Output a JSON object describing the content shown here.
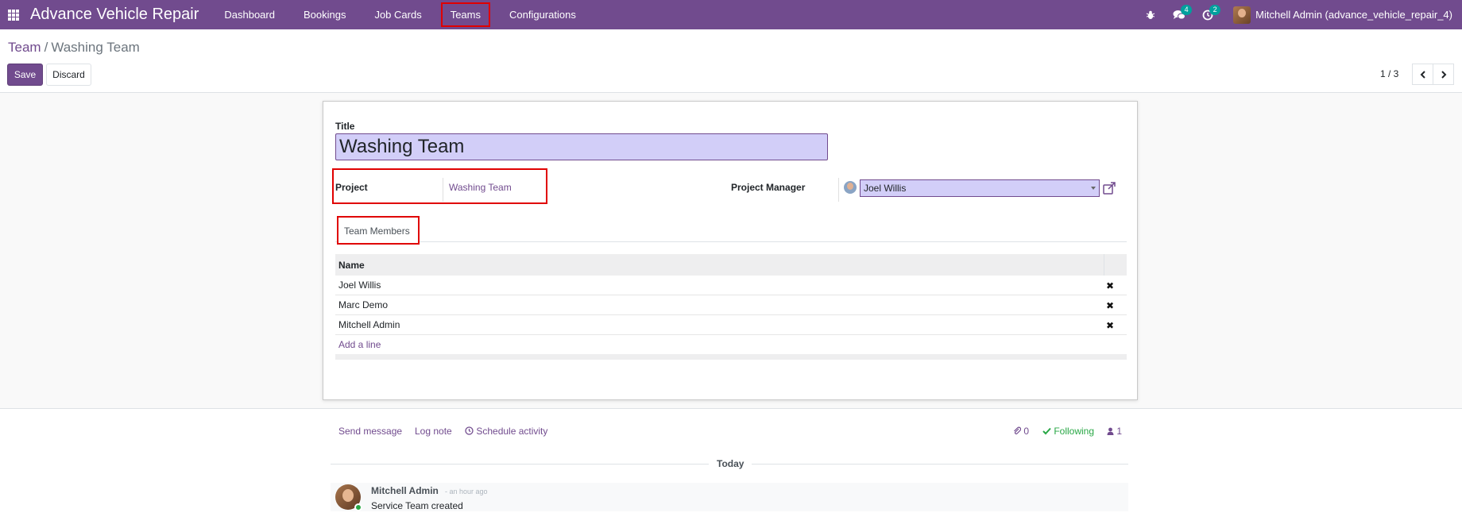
{
  "navbar": {
    "brand": "Advance Vehicle Repair",
    "menu": [
      "Dashboard",
      "Bookings",
      "Job Cards",
      "Teams",
      "Configurations"
    ],
    "active_menu": "Teams",
    "messages_count": "4",
    "activities_count": "2",
    "user": "Mitchell Admin (advance_vehicle_repair_4)",
    "accent_color": "#714b8e"
  },
  "control": {
    "breadcrumb_parent": "Team",
    "breadcrumb_sep": "/",
    "breadcrumb_current": "Washing Team",
    "save_label": "Save",
    "discard_label": "Discard",
    "pager": "1 / 3"
  },
  "form": {
    "title_label": "Title",
    "title_value": "Washing Team",
    "project_label": "Project",
    "project_value": "Washing Team",
    "manager_label": "Project Manager",
    "manager_value": "Joel Willis",
    "tab_label": "Team Members",
    "table": {
      "header": "Name",
      "rows": [
        "Joel Willis",
        "Marc Demo",
        "Mitchell Admin"
      ],
      "add_line": "Add a line"
    }
  },
  "chatter": {
    "send_message": "Send message",
    "log_note": "Log note",
    "schedule_activity": "Schedule activity",
    "attachments": "0",
    "following": "Following",
    "followers": "1",
    "date_separator": "Today",
    "message": {
      "author": "Mitchell Admin",
      "time": "- an hour ago",
      "body": "Service Team created"
    }
  }
}
